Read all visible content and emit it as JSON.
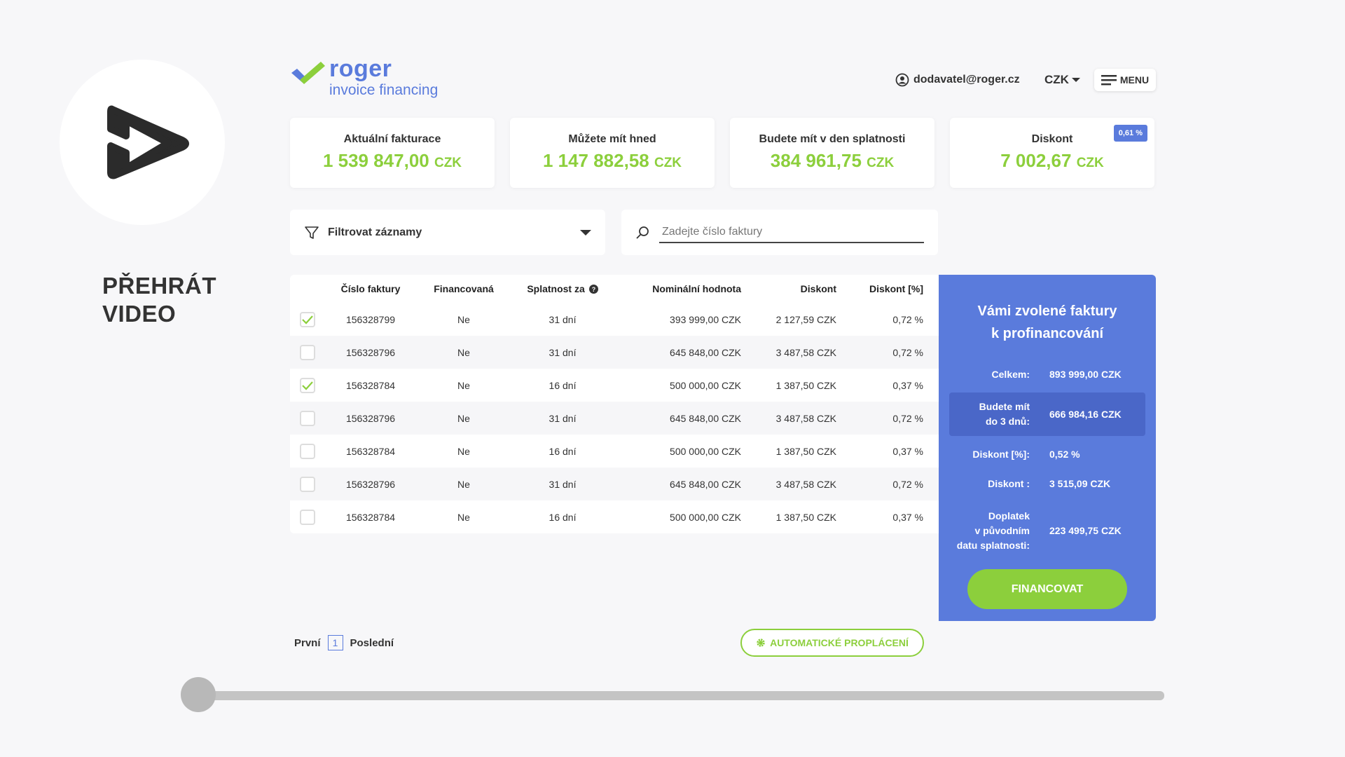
{
  "video": {
    "title_line1": "PŘEHRÁT",
    "title_line2": "VIDEO",
    "progress_fraction": 0.0
  },
  "logo": {
    "name": "roger",
    "tagline": "invoice financing",
    "icon": "checkmark-logo-icon"
  },
  "header": {
    "user_email": "dodavatel@roger.cz",
    "currency": "CZK",
    "menu_label": "MENU"
  },
  "summary": [
    {
      "label": "Aktuální fakturace",
      "value": "1 539 847,00",
      "currency": "CZK"
    },
    {
      "label": "Můžete mít hned",
      "value": "1 147 882,58",
      "currency": "CZK"
    },
    {
      "label": "Budete mít v den splatnosti",
      "value": "384 961,75",
      "currency": "CZK"
    },
    {
      "label": "Diskont",
      "value": "7 002,67",
      "currency": "CZK",
      "badge": "0,61 %"
    }
  ],
  "filter": {
    "label": "Filtrovat záznamy"
  },
  "search": {
    "placeholder": "Zadejte číslo faktury"
  },
  "table": {
    "headers": [
      "Číslo faktury",
      "Financovaná",
      "Splatnost za",
      "Nominální hodnota",
      "Diskont",
      "Diskont [%]"
    ],
    "rows": [
      {
        "checked": true,
        "number": "156328799",
        "financed": "Ne",
        "due": "31 dní",
        "nominal": "393 999,00 CZK",
        "discount": "2 127,59 CZK",
        "discount_pct": "0,72 %"
      },
      {
        "checked": false,
        "number": "156328796",
        "financed": "Ne",
        "due": "31 dní",
        "nominal": "645 848,00 CZK",
        "discount": "3 487,58 CZK",
        "discount_pct": "0,72 %"
      },
      {
        "checked": true,
        "number": "156328784",
        "financed": "Ne",
        "due": "16 dní",
        "nominal": "500 000,00 CZK",
        "discount": "1 387,50 CZK",
        "discount_pct": "0,37 %"
      },
      {
        "checked": false,
        "number": "156328796",
        "financed": "Ne",
        "due": "31 dní",
        "nominal": "645 848,00 CZK",
        "discount": "3 487,58 CZK",
        "discount_pct": "0,72 %"
      },
      {
        "checked": false,
        "number": "156328784",
        "financed": "Ne",
        "due": "16 dní",
        "nominal": "500 000,00 CZK",
        "discount": "1 387,50 CZK",
        "discount_pct": "0,37 %"
      },
      {
        "checked": false,
        "number": "156328796",
        "financed": "Ne",
        "due": "31 dní",
        "nominal": "645 848,00 CZK",
        "discount": "3 487,58 CZK",
        "discount_pct": "0,72 %"
      },
      {
        "checked": false,
        "number": "156328784",
        "financed": "Ne",
        "due": "16 dní",
        "nominal": "500 000,00 CZK",
        "discount": "1 387,50 CZK",
        "discount_pct": "0,37 %"
      }
    ]
  },
  "panel": {
    "title_line1": "Vámi zvolené faktury",
    "title_line2": "k profinancování",
    "total_label": "Celkem:",
    "total_value": "893 999,00 CZK",
    "within_label_1": "Budete mít",
    "within_label_2": "do 3 dnů:",
    "within_value": "666 984,16 CZK",
    "discount_pct_label": "Diskont [%]:",
    "discount_pct_value": "0,52 %",
    "discount_label": "Diskont :",
    "discount_value": "3 515,09 CZK",
    "surcharge_label_1": "Doplatek",
    "surcharge_label_2": "v původním",
    "surcharge_label_3": "datu splatnosti:",
    "surcharge_value": "223 499,75 CZK",
    "button_label": "FINANCOVAT"
  },
  "pager": {
    "first": "První",
    "current": "1",
    "last": "Poslední"
  },
  "auto_button": {
    "label": "AUTOMATICKÉ PROPLÁCENÍ"
  },
  "colors": {
    "accent_blue": "#5a7bdc",
    "accent_green": "#8ccf3c"
  }
}
